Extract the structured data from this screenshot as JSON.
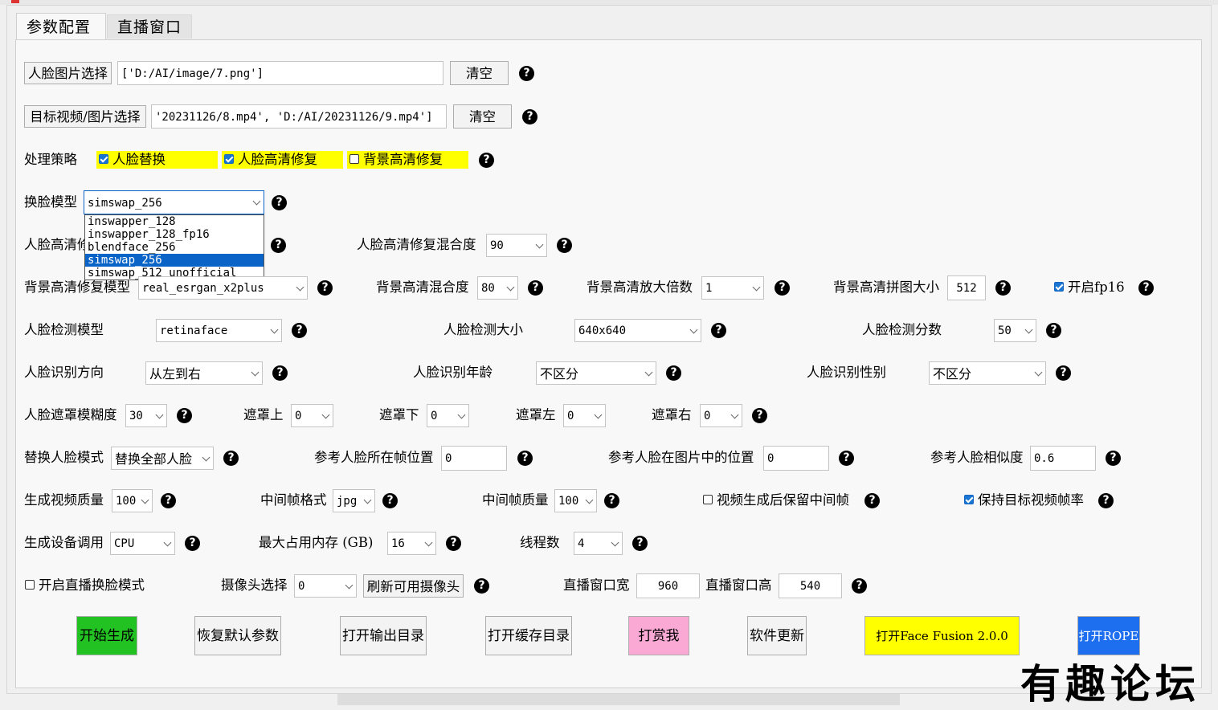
{
  "tabs": [
    {
      "label": "参数配置",
      "active": true
    },
    {
      "label": "直播窗口",
      "active": false
    }
  ],
  "source_face": {
    "button": "人脸图片选择",
    "value": "['D:/AI/image/7.png']",
    "clear": "清空"
  },
  "target": {
    "button": "目标视频/图片选择",
    "value": "'20231126/8.mp4', 'D:/AI/20231126/9.mp4']",
    "clear": "清空"
  },
  "strategy": {
    "label": "处理策略",
    "options": [
      {
        "label": "人脸替换",
        "checked": true
      },
      {
        "label": "人脸高清修复",
        "checked": true
      },
      {
        "label": "背景高清修复",
        "checked": false
      }
    ]
  },
  "swap_model": {
    "label": "换脸模型",
    "value": "simswap_256",
    "options": [
      "inswapper_128",
      "inswapper_128_fp16",
      "blendface_256",
      "simswap_256",
      "simswap_512_unofficial"
    ],
    "selected_index": 3
  },
  "enhance": {
    "label_partial": "人脸高清修",
    "blend_label": "人脸高清修复混合度",
    "blend_value": "90"
  },
  "bg": {
    "model_label": "背景高清修复模型",
    "model_value": "real_esrgan_x2plus",
    "blend_label": "背景高清混合度",
    "blend_value": "80",
    "scale_label": "背景高清放大倍数",
    "scale_value": "1",
    "tile_label": "背景高清拼图大小",
    "tile_value": "512",
    "fp16_label": "开启fp16",
    "fp16_checked": true
  },
  "detect": {
    "model_label": "人脸检测模型",
    "model_value": "retinaface",
    "size_label": "人脸检测大小",
    "size_value": "640x640",
    "score_label": "人脸检测分数",
    "score_value": "50"
  },
  "recognize": {
    "dir_label": "人脸识别方向",
    "dir_value": "从左到右",
    "age_label": "人脸识别年龄",
    "age_value": "不区分",
    "gender_label": "人脸识别性别",
    "gender_value": "不区分"
  },
  "mask": {
    "blur_label": "人脸遮罩模糊度",
    "blur_value": "30",
    "top_label": "遮罩上",
    "top_value": "0",
    "bottom_label": "遮罩下",
    "bottom_value": "0",
    "left_label": "遮罩左",
    "left_value": "0",
    "right_label": "遮罩右",
    "right_value": "0"
  },
  "replace": {
    "mode_label": "替换人脸模式",
    "mode_value": "替换全部人脸",
    "ref_frame_label": "参考人脸所在帧位置",
    "ref_frame_value": "0",
    "ref_pos_label": "参考人脸在图片中的位置",
    "ref_pos_value": "0",
    "sim_label": "参考人脸相似度",
    "sim_value": "0.6"
  },
  "output": {
    "quality_label": "生成视频质量",
    "quality_value": "100",
    "fmt_label": "中间帧格式",
    "fmt_value": "jpg",
    "frame_q_label": "中间帧质量",
    "frame_q_value": "100",
    "keep_frames_label": "视频生成后保留中间帧",
    "keep_frames_checked": false,
    "keep_fps_label": "保持目标视频帧率",
    "keep_fps_checked": true
  },
  "device": {
    "device_label": "生成设备调用",
    "device_value": "CPU",
    "mem_label": "最大占用内存 (GB)",
    "mem_value": "16",
    "threads_label": "线程数",
    "threads_value": "4"
  },
  "live": {
    "mode_label": "开启直播换脸模式",
    "mode_checked": false,
    "cam_label": "摄像头选择",
    "cam_value": "0",
    "refresh_btn": "刷新可用摄像头",
    "w_label": "直播窗口宽",
    "w_value": "960",
    "h_label": "直播窗口高",
    "h_value": "540"
  },
  "actions": {
    "start": "开始生成",
    "reset": "恢复默认参数",
    "open_output": "打开输出目录",
    "open_cache": "打开缓存目录",
    "donate": "打赏我",
    "update": "软件更新",
    "open_ff": "打开Face Fusion 2.0.0",
    "open_rope": "打开ROPE"
  },
  "colors": {
    "start_bg": "#22c222",
    "donate_bg": "#f9a9d4",
    "ff_bg": "#ffff00",
    "rope_bg": "#1e6ff0",
    "rope_fg": "#ffffff",
    "highlight": "#ffff00",
    "selection": "#0a64c8"
  },
  "help_glyph": "?",
  "watermark": "有趣论坛"
}
